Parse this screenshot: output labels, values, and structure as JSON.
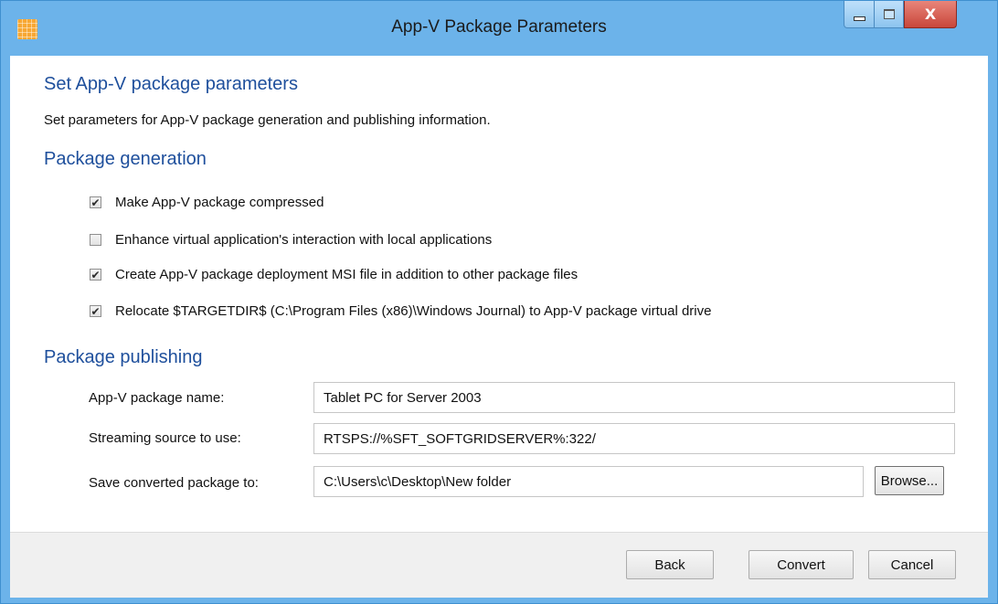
{
  "window": {
    "title": "App-V Package Parameters",
    "icons": {
      "app": "app-grid-icon",
      "minimize": "minimize-icon",
      "maximize": "maximize-icon",
      "close": "close-icon"
    },
    "close_glyph": "X"
  },
  "page": {
    "heading": "Set App-V package parameters",
    "description": "Set parameters for App-V package generation and publishing information."
  },
  "generation": {
    "heading": "Package generation",
    "options": [
      {
        "label": "Make App-V package compressed",
        "checked": true
      },
      {
        "label": "Enhance virtual application's interaction with local applications",
        "checked": false
      },
      {
        "label": "Create App-V package deployment MSI file in addition to other package files",
        "checked": true
      },
      {
        "label": "Relocate $TARGETDIR$ (C:\\Program Files (x86)\\Windows Journal) to App-V package virtual drive",
        "checked": true
      }
    ]
  },
  "publishing": {
    "heading": "Package publishing",
    "package_name": {
      "label": "App-V package name:",
      "value": "Tablet PC for Server 2003"
    },
    "streaming_source": {
      "label": "Streaming source to use:",
      "value": "RTSPS://%SFT_SOFTGRIDSERVER%:322/"
    },
    "save_to": {
      "label": "Save converted package to:",
      "value": "C:\\Users\\c\\Desktop\\New folder"
    },
    "browse_label": "Browse..."
  },
  "footer": {
    "back_label": "Back",
    "convert_label": "Convert",
    "cancel_label": "Cancel"
  },
  "colors": {
    "accent": "#1e4f9c",
    "titlebar": "#6cb3ea",
    "close_button": "#c8463a"
  }
}
